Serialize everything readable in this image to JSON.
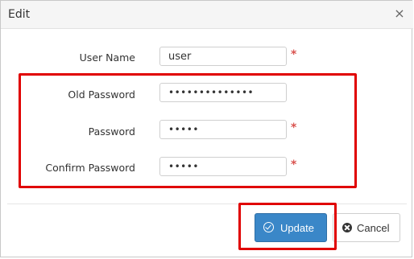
{
  "dialog": {
    "title": "Edit",
    "close_glyph": "×"
  },
  "form": {
    "username_label": "User Name",
    "username_value": "user",
    "old_password_label": "Old Password",
    "old_password_value": "••••••••••••••",
    "password_label": "Password",
    "password_value": "•••••",
    "confirm_password_label": "Confirm Password",
    "confirm_password_value": "•••••",
    "required_mark": "*"
  },
  "buttons": {
    "update_label": "Update",
    "cancel_label": "Cancel"
  },
  "icons": {
    "update": "check-circle-icon",
    "cancel": "times-circle-icon",
    "close": "close-icon"
  },
  "colors": {
    "highlight": "#e00000",
    "primary": "#3a87c8",
    "required": "#d9534f"
  }
}
